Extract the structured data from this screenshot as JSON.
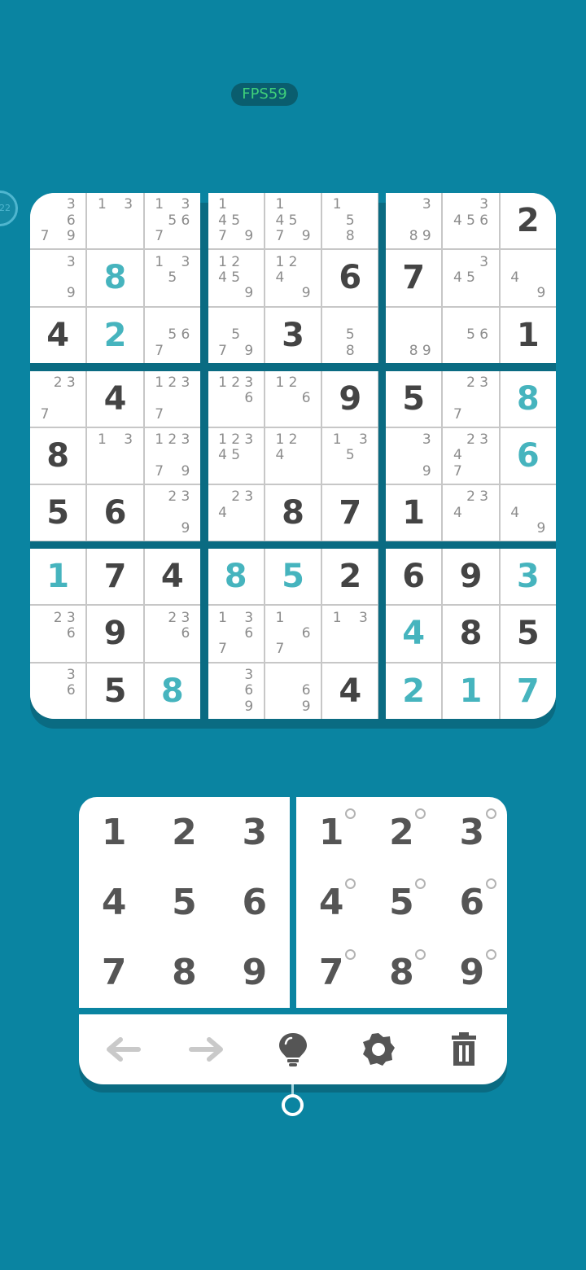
{
  "status": {
    "fps_label": "FPS59",
    "edge_badge": "22"
  },
  "board": {
    "rows": [
      [
        {
          "n": "3679"
        },
        {
          "n": "13"
        },
        {
          "n": "13567"
        },
        {
          "n": "14579"
        },
        {
          "n": "14579"
        },
        {
          "n": "158"
        },
        {
          "n": "389"
        },
        {
          "n": "3456"
        },
        {
          "g": "2"
        }
      ],
      [
        {
          "n": "39"
        },
        {
          "u": "8"
        },
        {
          "n": "135"
        },
        {
          "n": "12459"
        },
        {
          "n": "1249"
        },
        {
          "g": "6"
        },
        {
          "g": "7"
        },
        {
          "n": "345"
        },
        {
          "n": "49"
        }
      ],
      [
        {
          "g": "4"
        },
        {
          "u": "2"
        },
        {
          "n": "567"
        },
        {
          "n": "579"
        },
        {
          "g": "3"
        },
        {
          "n": "58"
        },
        {
          "n": "89"
        },
        {
          "n": "56"
        },
        {
          "g": "1"
        }
      ],
      [
        {
          "n": "237"
        },
        {
          "g": "4"
        },
        {
          "n": "1237"
        },
        {
          "n": "1236"
        },
        {
          "n": "126"
        },
        {
          "g": "9"
        },
        {
          "g": "5"
        },
        {
          "n": "237"
        },
        {
          "u": "8"
        }
      ],
      [
        {
          "g": "8"
        },
        {
          "n": "13"
        },
        {
          "n": "12379"
        },
        {
          "n": "12345"
        },
        {
          "n": "124"
        },
        {
          "n": "135"
        },
        {
          "n": "39"
        },
        {
          "n": "2347"
        },
        {
          "u": "6"
        }
      ],
      [
        {
          "g": "5"
        },
        {
          "g": "6"
        },
        {
          "n": "239"
        },
        {
          "n": "234"
        },
        {
          "g": "8"
        },
        {
          "g": "7"
        },
        {
          "g": "1"
        },
        {
          "n": "234"
        },
        {
          "n": "49"
        }
      ],
      [
        {
          "u": "1"
        },
        {
          "g": "7"
        },
        {
          "g": "4"
        },
        {
          "u": "8"
        },
        {
          "u": "5"
        },
        {
          "g": "2"
        },
        {
          "g": "6"
        },
        {
          "g": "9"
        },
        {
          "u": "3"
        }
      ],
      [
        {
          "n": "236"
        },
        {
          "g": "9"
        },
        {
          "n": "236"
        },
        {
          "n": "1367"
        },
        {
          "n": "167"
        },
        {
          "n": "13"
        },
        {
          "u": "4"
        },
        {
          "g": "8"
        },
        {
          "g": "5"
        }
      ],
      [
        {
          "n": "36"
        },
        {
          "g": "5"
        },
        {
          "u": "8"
        },
        {
          "n": "369"
        },
        {
          "n": "69"
        },
        {
          "g": "4"
        },
        {
          "u": "2"
        },
        {
          "u": "1"
        },
        {
          "u": "7"
        }
      ]
    ]
  },
  "keypad": {
    "digits": [
      "1",
      "2",
      "3",
      "4",
      "5",
      "6",
      "7",
      "8",
      "9"
    ],
    "notes_digits": [
      "1",
      "2",
      "3",
      "4",
      "5",
      "6",
      "7",
      "8",
      "9"
    ]
  },
  "toolbar": {
    "icons": [
      "undo-arrow-icon",
      "redo-arrow-icon",
      "hint-bulb-icon",
      "settings-gear-icon",
      "trash-icon"
    ]
  },
  "colors": {
    "background": "#0a84a1",
    "given_digit": "#444444",
    "user_digit": "#46b4be",
    "notes": "#8c8c8c"
  }
}
